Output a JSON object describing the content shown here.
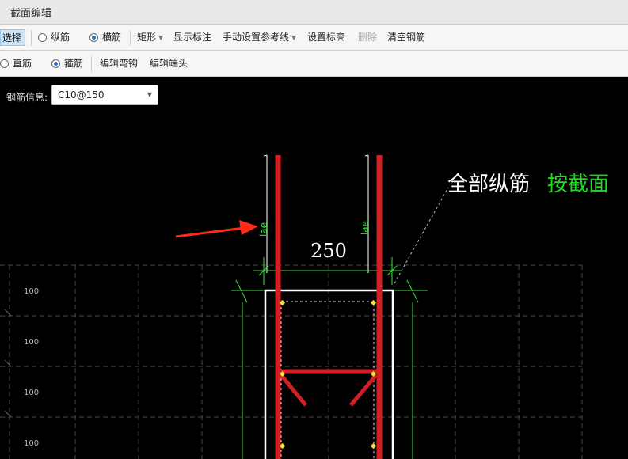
{
  "window": {
    "title": "截面编辑"
  },
  "toolbar1": {
    "select": "选择",
    "longitudinal": "纵筋",
    "transverse": "横筋",
    "shape": "矩形",
    "show_dims": "显示标注",
    "manual_ref": "手动设置参考线",
    "set_elev": "设置标高",
    "delete": "删除",
    "clear": "清空钢筋"
  },
  "toolbar2": {
    "straight": "直筋",
    "stirrup": "箍筋",
    "edit_hook": "编辑弯钩",
    "edit_end": "编辑端头"
  },
  "rebar_info": {
    "label": "钢筋信息:",
    "value": "C10@150"
  },
  "drawing": {
    "dimension": "250",
    "annotation_all": "全部纵筋",
    "annotation_section": "按截面",
    "anchor_left": "lae",
    "anchor_right": "lae",
    "grid_labels": [
      "100",
      "100",
      "100",
      "100"
    ],
    "colors": {
      "rebar": "#d21f26",
      "dim": "#3fe040",
      "outline": "#ffffff",
      "accent": "#26d626",
      "arrow": "#ff2a1a"
    }
  }
}
